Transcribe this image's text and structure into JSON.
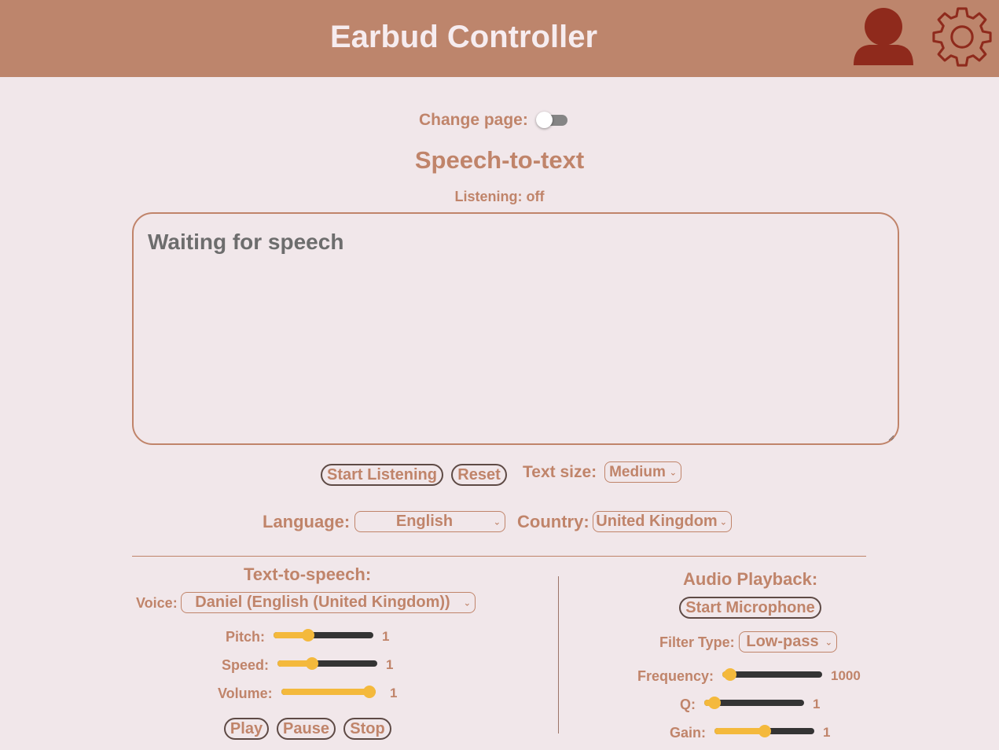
{
  "header": {
    "title": "Earbud Controller"
  },
  "toggle": {
    "label": "Change page:",
    "state": "off"
  },
  "stt": {
    "title": "Speech-to-text",
    "status": "Listening: off",
    "transcript": "Waiting for speech",
    "start_label": "Start Listening",
    "reset_label": "Reset",
    "text_size_label": "Text size:",
    "text_size_value": "Medium",
    "language_label": "Language:",
    "language_value": "English",
    "country_label": "Country:",
    "country_value": "United Kingdom"
  },
  "tts": {
    "title": "Text-to-speech:",
    "voice_label": "Voice:",
    "voice_value": "Daniel (English (United Kingdom))",
    "pitch": {
      "label": "Pitch:",
      "value": "1",
      "level": 0.35
    },
    "speed": {
      "label": "Speed:",
      "value": "1",
      "level": 0.35
    },
    "volume": {
      "label": "Volume:",
      "value": "1",
      "level": 1.0
    },
    "play_label": "Play",
    "pause_label": "Pause",
    "stop_label": "Stop"
  },
  "audio": {
    "title": "Audio Playback:",
    "mic_label": "Start Microphone",
    "filter_label": "Filter Type:",
    "filter_value": "Low-pass",
    "frequency": {
      "label": "Frequency:",
      "value": "1000",
      "level": 0.08
    },
    "q": {
      "label": "Q:",
      "value": "1",
      "level": 0.1
    },
    "gain": {
      "label": "Gain:",
      "value": "1",
      "level": 0.5
    }
  },
  "colors": {
    "header_bg": "#bd856c",
    "accent": "#c0846a",
    "icon": "#8f2a1c",
    "slider_fill": "#f4b93c"
  }
}
